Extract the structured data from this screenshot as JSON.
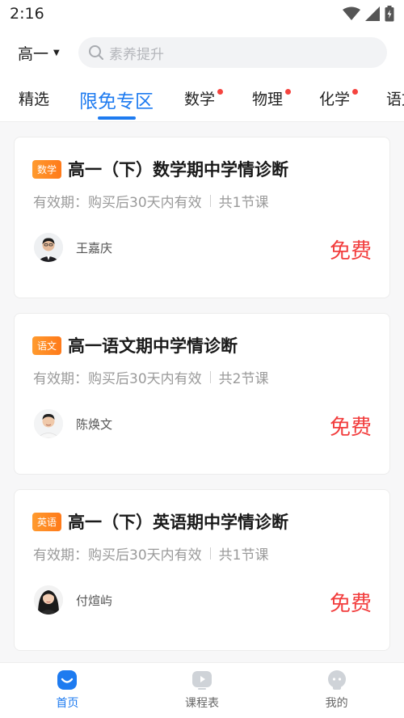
{
  "status_bar": {
    "time": "2:16"
  },
  "header": {
    "grade": "高一",
    "search_placeholder": "素养提升"
  },
  "tabs": [
    {
      "label": "精选",
      "active": false,
      "dot": false
    },
    {
      "label": "限免专区",
      "active": true,
      "dot": false
    },
    {
      "label": "数学",
      "active": false,
      "dot": true
    },
    {
      "label": "物理",
      "active": false,
      "dot": true
    },
    {
      "label": "化学",
      "active": false,
      "dot": true
    },
    {
      "label": "语文",
      "active": false,
      "dot": false
    }
  ],
  "courses": [
    {
      "tag": "数学",
      "title": "高一（下）数学期中学情诊断",
      "validity": "有效期：购买后30天内有效",
      "lessons": "共1节课",
      "teacher": "王嘉庆",
      "price": "免费"
    },
    {
      "tag": "语文",
      "title": "高一语文期中学情诊断",
      "validity": "有效期：购买后30天内有效",
      "lessons": "共2节课",
      "teacher": "陈焕文",
      "price": "免费"
    },
    {
      "tag": "英语",
      "title": "高一（下）英语期中学情诊断",
      "validity": "有效期：购买后30天内有效",
      "lessons": "共1节课",
      "teacher": "付煊屿",
      "price": "免费"
    }
  ],
  "bottom_nav": [
    {
      "label": "首页",
      "icon": "home-icon",
      "active": true
    },
    {
      "label": "课程表",
      "icon": "schedule-icon",
      "active": false
    },
    {
      "label": "我的",
      "icon": "profile-icon",
      "active": false
    }
  ],
  "colors": {
    "accent": "#1e7bf0",
    "price": "#f23d3d",
    "tag": "#ff8a24"
  }
}
